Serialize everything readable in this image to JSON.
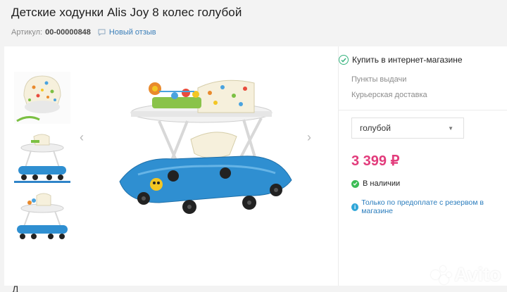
{
  "product": {
    "title": "Детские ходунки Alis Joy 8 колес голубой",
    "sku_label": "Артикул:",
    "sku_value": "00-00000848",
    "review_link": "Новый отзыв"
  },
  "gallery": {
    "prev_arrow": "‹",
    "next_arrow": "›",
    "thumbnail_count": 3,
    "active_thumbnail": 2
  },
  "purchase": {
    "buy_online": "Купить в интернет-магазине",
    "pickup_points": "Пункты выдачи",
    "courier_delivery": "Курьерская доставка",
    "color_select": {
      "value": "голубой",
      "caret": "▼"
    },
    "price": "3 399 ₽",
    "availability": "В наличии",
    "prepay_note": "Только по предоплате с резервом в магазине"
  },
  "watermark": {
    "brand": "Avito"
  },
  "bottom_fragment": "Д",
  "colors": {
    "accent_price": "#e23b7b",
    "link": "#3b7fb9",
    "walker_blue": "#2f8fd1",
    "in_stock_green": "#3cbc55",
    "check_green": "#36b37e"
  }
}
